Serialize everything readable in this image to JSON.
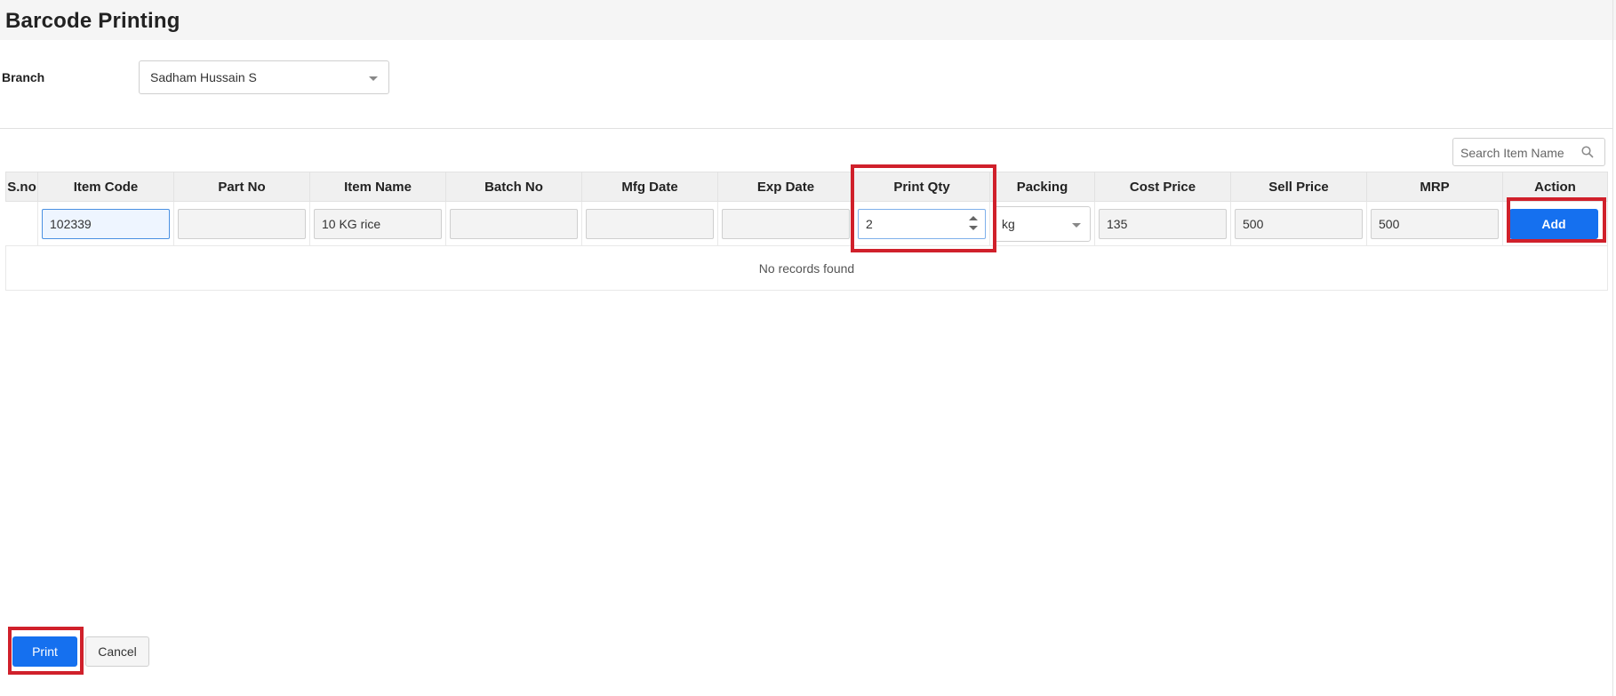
{
  "page": {
    "title": "Barcode Printing"
  },
  "branch": {
    "label": "Branch",
    "selected": "Sadham Hussain S"
  },
  "search": {
    "placeholder": "Search Item Name"
  },
  "table": {
    "headers": {
      "sno": "S.no",
      "item_code": "Item Code",
      "part_no": "Part No",
      "item_name": "Item Name",
      "batch_no": "Batch No",
      "mfg_date": "Mfg Date",
      "exp_date": "Exp Date",
      "print_qty": "Print Qty",
      "packing": "Packing",
      "cost_price": "Cost Price",
      "sell_price": "Sell Price",
      "mrp": "MRP",
      "action": "Action"
    },
    "entry": {
      "item_code": "102339",
      "part_no": "",
      "item_name": "10 KG rice",
      "batch_no": "",
      "mfg_date": "",
      "exp_date": "",
      "print_qty": "2",
      "packing": "kg",
      "cost_price": "135",
      "sell_price": "500",
      "mrp": "500",
      "add_label": "Add"
    },
    "empty_message": "No records found"
  },
  "footer": {
    "print_label": "Print",
    "cancel_label": "Cancel"
  },
  "colors": {
    "primary": "#1570ef",
    "highlight": "#d0202b"
  }
}
